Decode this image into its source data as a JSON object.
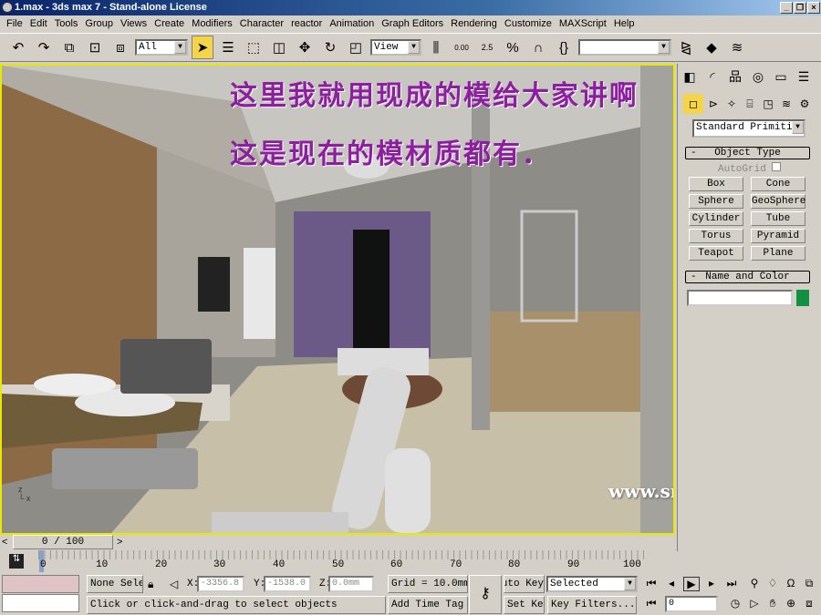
{
  "title": "1.max - 3ds max 7 - Stand-alone License",
  "window_buttons": {
    "min": "_",
    "max": "❐",
    "close": "×"
  },
  "menu": [
    "File",
    "Edit",
    "Tools",
    "Group",
    "Views",
    "Create",
    "Modifiers",
    "Character",
    "reactor",
    "Animation",
    "Graph Editors",
    "Rendering",
    "Customize",
    "MAXScript",
    "Help"
  ],
  "toolbar": {
    "selection_filter": "All",
    "ref_coord": "View",
    "spinner_snap": "0.00",
    "angle_snap": "2.5",
    "named_selection": ""
  },
  "viewport": {
    "overlay_line1": "这里我就用现成的模给大家讲啊",
    "overlay_line2": "这是现在的模材质都有．",
    "watermark": "www.snren.com"
  },
  "command_panel": {
    "category": "Standard Primitiv",
    "object_type_title": "Object Type",
    "autogrid": "AutoGrid",
    "buttons": [
      "Box",
      "Cone",
      "Sphere",
      "GeoSphere",
      "Cylinder",
      "Tube",
      "Torus",
      "Pyramid",
      "Teapot",
      "Plane"
    ],
    "name_color_title": "Name and Color",
    "name_value": "",
    "object_color": "#109040"
  },
  "timeline": {
    "frame_display": "0 / 100",
    "prev": "<",
    "next": ">",
    "ticks": [
      "0",
      "10",
      "20",
      "30",
      "40",
      "50",
      "60",
      "70",
      "80",
      "90",
      "100"
    ]
  },
  "status": {
    "selection": "None Sele",
    "x": "-3356.8",
    "y": "-1538.0",
    "z": "0.0mm",
    "x_label": "X:",
    "y_label": "Y:",
    "z_label": "Z:",
    "grid": "Grid = 10.0mm",
    "prompt": "Click or click-and-drag to select objects",
    "add_time_tag": "Add Time Tag",
    "auto_key": "Auto Key",
    "set_key": "Set Key",
    "key_mode": "Selected",
    "key_filters": "Key Filters...",
    "current_frame": "0"
  }
}
